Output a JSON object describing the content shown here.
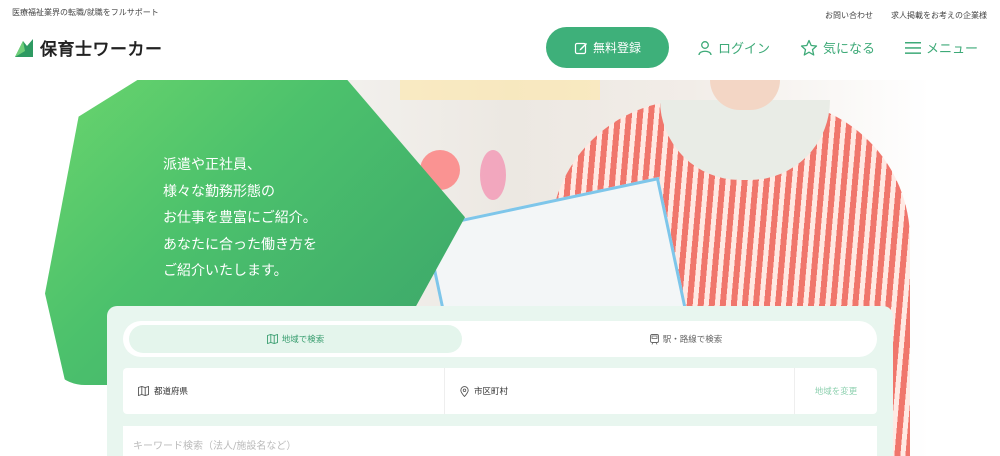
{
  "header": {
    "tagline": "医療福祉業界の転職/就職をフルサポート",
    "links": [
      "お問い合わせ",
      "求人掲載をお考えの企業様"
    ],
    "logo_text": "保育士ワーカー",
    "signup_label": "無料登録",
    "login_label": "ログイン",
    "favorite_label": "気になる",
    "menu_label": "メニュー",
    "accent": "#3eb07a"
  },
  "hero": {
    "lines": [
      "派遣や正社員、",
      "様々な勤務形態の",
      "お仕事を豊富にご紹介。",
      "あなたに合った働き方を",
      "ご紹介いたします。"
    ]
  },
  "search": {
    "tab_area": "地域で検索",
    "tab_station": "駅・路線で検索",
    "prefecture": "都道府県",
    "city": "市区町村",
    "change_label": "地域を変更",
    "keyword_placeholder": "キーワード検索（法人/施設名など）"
  }
}
